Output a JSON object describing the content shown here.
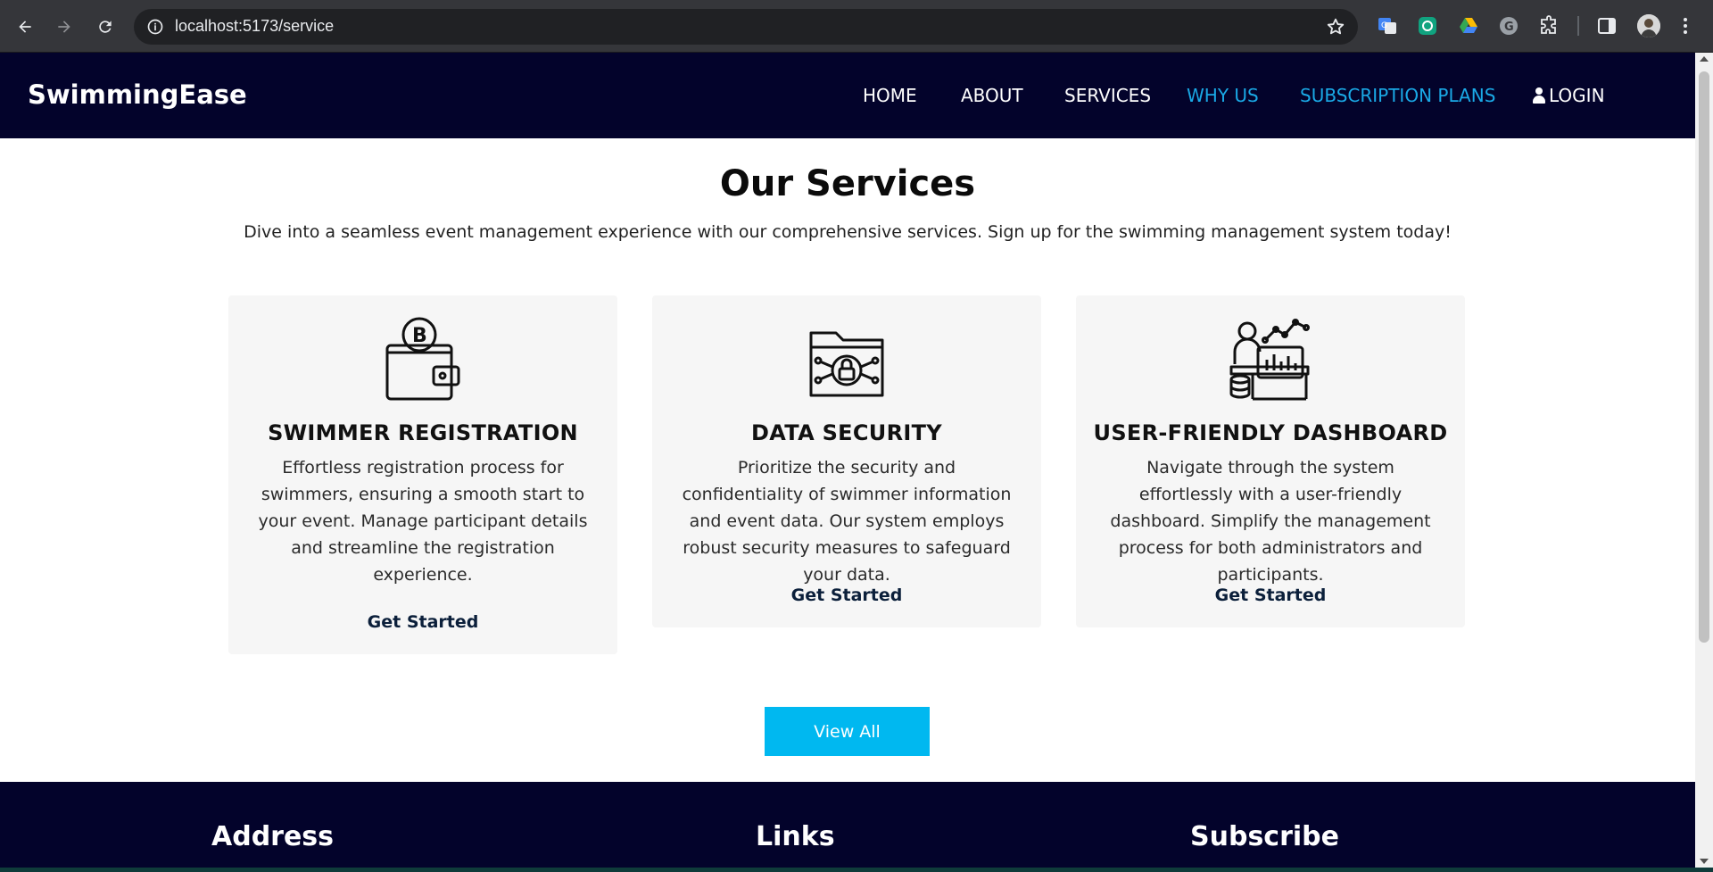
{
  "browser": {
    "url": "localhost:5173/service",
    "extensions": [
      "google-translate-icon",
      "chatgpt-extension-icon",
      "google-drive-icon",
      "grammarly-icon",
      "extensions-puzzle-icon"
    ]
  },
  "header": {
    "brand": "SwimmingEase",
    "nav": [
      {
        "label": "HOME"
      },
      {
        "label": "ABOUT"
      },
      {
        "label": "SERVICES"
      },
      {
        "label": "WHY US"
      },
      {
        "label": "SUBSCRIPTION PLANS"
      },
      {
        "label": "LOGIN"
      }
    ]
  },
  "services": {
    "title": "Our Services",
    "subtitle": "Dive into a seamless event management experience with our comprehensive services. Sign up for the swimming management system today!",
    "cards": [
      {
        "icon": "wallet-bitcoin-icon",
        "title": "SWIMMER REGISTRATION",
        "text": "Effortless registration process for swimmers, ensuring a smooth start to your event. Manage participant details and streamline the registration experience.",
        "cta": "Get Started"
      },
      {
        "icon": "secure-folder-icon",
        "title": "DATA SECURITY",
        "text": "Prioritize the security and confidentiality of swimmer information and event data. Our system employs robust security measures to safeguard your data.",
        "cta": "Get Started"
      },
      {
        "icon": "dashboard-analytics-icon",
        "title": "USER-FRIENDLY DASHBOARD",
        "text": "Navigate through the system effortlessly with a user-friendly dashboard. Simplify the management process for both administrators and participants.",
        "cta": "Get Started"
      }
    ],
    "view_all": "View All"
  },
  "footer": {
    "address_heading": "Address",
    "links_heading": "Links",
    "subscribe_heading": "Subscribe"
  },
  "colors": {
    "navy": "#03032b",
    "accent": "#1aa9e6",
    "button": "#00b8f0",
    "card_bg": "#f6f6f6"
  }
}
